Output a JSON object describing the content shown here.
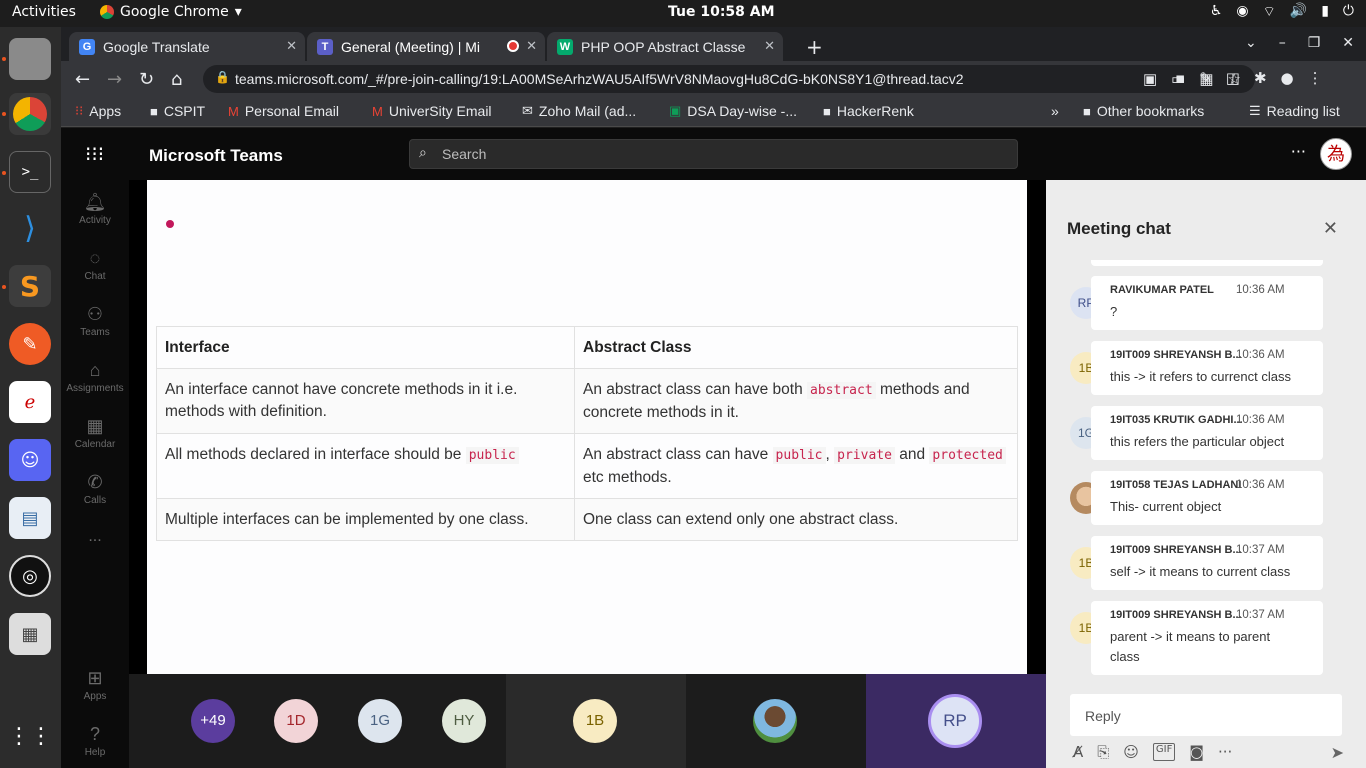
{
  "desktop": {
    "activities": "Activities",
    "app_name": "Google Chrome",
    "clock": "Tue 10:58 AM"
  },
  "browser": {
    "tabs": [
      {
        "title": "Google Translate"
      },
      {
        "title": "General (Meeting) | Mi"
      },
      {
        "title": "PHP OOP Abstract Classe"
      }
    ],
    "url": "teams.microsoft.com/_#/pre-join-calling/19:LA00MSeArhzWAU5AIf5WrV8NMaovgHu8CdG-bK0NS8Y1@thread.tacv2",
    "bookmarks": [
      "Apps",
      "CSPIT",
      "Personal Email",
      "UniverSity Email",
      "Zoho Mail (ad...",
      "DSA Day-wise -...",
      "HackerRenk"
    ],
    "bookmarks_more": "»",
    "other_bookmarks": "Other bookmarks",
    "reading_list": "Reading list"
  },
  "teams": {
    "title": "Microsoft Teams",
    "search_placeholder": "Search",
    "rail": [
      {
        "label": "Activity",
        "icon": "bell-icon"
      },
      {
        "label": "Chat",
        "icon": "chat-icon"
      },
      {
        "label": "Teams",
        "icon": "teams-icon"
      },
      {
        "label": "Assignments",
        "icon": "assignments-icon"
      },
      {
        "label": "Calendar",
        "icon": "calendar-icon"
      },
      {
        "label": "Calls",
        "icon": "phone-icon"
      },
      {
        "label": "...",
        "icon": "more-icon"
      },
      {
        "label": "Apps",
        "icon": "apps-icon"
      },
      {
        "label": "Help",
        "icon": "help-icon"
      }
    ]
  },
  "slide": {
    "headers": [
      "Interface",
      "Abstract Class"
    ],
    "rows": [
      {
        "left": [
          "An interface cannot have concrete methods in it i.e. methods with definition."
        ],
        "right": [
          "An abstract class can have both ",
          "abstract",
          " methods and concrete methods in it."
        ]
      },
      {
        "left": [
          "All methods declared in interface should be ",
          "public"
        ],
        "right": [
          "An abstract class can have ",
          "public",
          ", ",
          "private",
          " and ",
          "protected",
          " etc methods."
        ]
      },
      {
        "left": [
          "Multiple interfaces can be implemented by one class."
        ],
        "right": [
          "One class can extend only one abstract class."
        ]
      }
    ]
  },
  "participants": [
    {
      "label": "+49",
      "bg": "#5b3d9e",
      "fg": "#ffffff"
    },
    {
      "label": "1D",
      "bg": "#f2d4d7",
      "fg": "#a4262c"
    },
    {
      "label": "1G",
      "bg": "#dde5ee",
      "fg": "#4a6282"
    },
    {
      "label": "HY",
      "bg": "#e0e8da",
      "fg": "#4f5d42"
    },
    {
      "label": "1B",
      "bg": "#f8ebc2",
      "fg": "#7a6200"
    },
    {
      "label": "",
      "bg": "#8bbf8a",
      "fg": "#ffffff"
    },
    {
      "label": "RP",
      "bg": "#dde3f5",
      "fg": "#444f8a"
    }
  ],
  "chat": {
    "title": "Meeting chat",
    "messages": [
      {
        "author": "RAVIKUMAR PATEL",
        "time": "10:36 AM",
        "text": "?",
        "initials": "RP",
        "avatar_bg": "#dce3f2",
        "avatar_fg": "#3f4f8a",
        "status": "#c4314b"
      },
      {
        "author": "19IT009 SHREYANSH B...",
        "time": "10:36 AM",
        "text": "this -> it refers to currenct class",
        "initials": "1B",
        "avatar_bg": "#f8ebc2",
        "avatar_fg": "#7a6200",
        "status": "#c4314b"
      },
      {
        "author": "19IT035 KRUTIK GADHI...",
        "time": "10:36 AM",
        "text": "this refers the particular object",
        "initials": "1G",
        "avatar_bg": "#dde5ee",
        "avatar_fg": "#4a6282",
        "status": "#c4314b"
      },
      {
        "author": "19IT058 TEJAS LADHANI",
        "time": "10:36 AM",
        "text": "This- current object",
        "initials": "",
        "avatar_bg": "#d9b48f",
        "avatar_fg": "#ffffff",
        "status": "#f8d22a"
      },
      {
        "author": "19IT009 SHREYANSH B...",
        "time": "10:37 AM",
        "text": "self -> it means to current class",
        "initials": "1B",
        "avatar_bg": "#f8ebc2",
        "avatar_fg": "#7a6200",
        "status": "#c4314b"
      },
      {
        "author": "19IT009 SHREYANSH B...",
        "time": "10:37 AM",
        "text": "parent -> it means to parent class",
        "initials": "1B",
        "avatar_bg": "#f8ebc2",
        "avatar_fg": "#7a6200",
        "status": "#c4314b"
      }
    ],
    "reply_placeholder": "Reply"
  }
}
